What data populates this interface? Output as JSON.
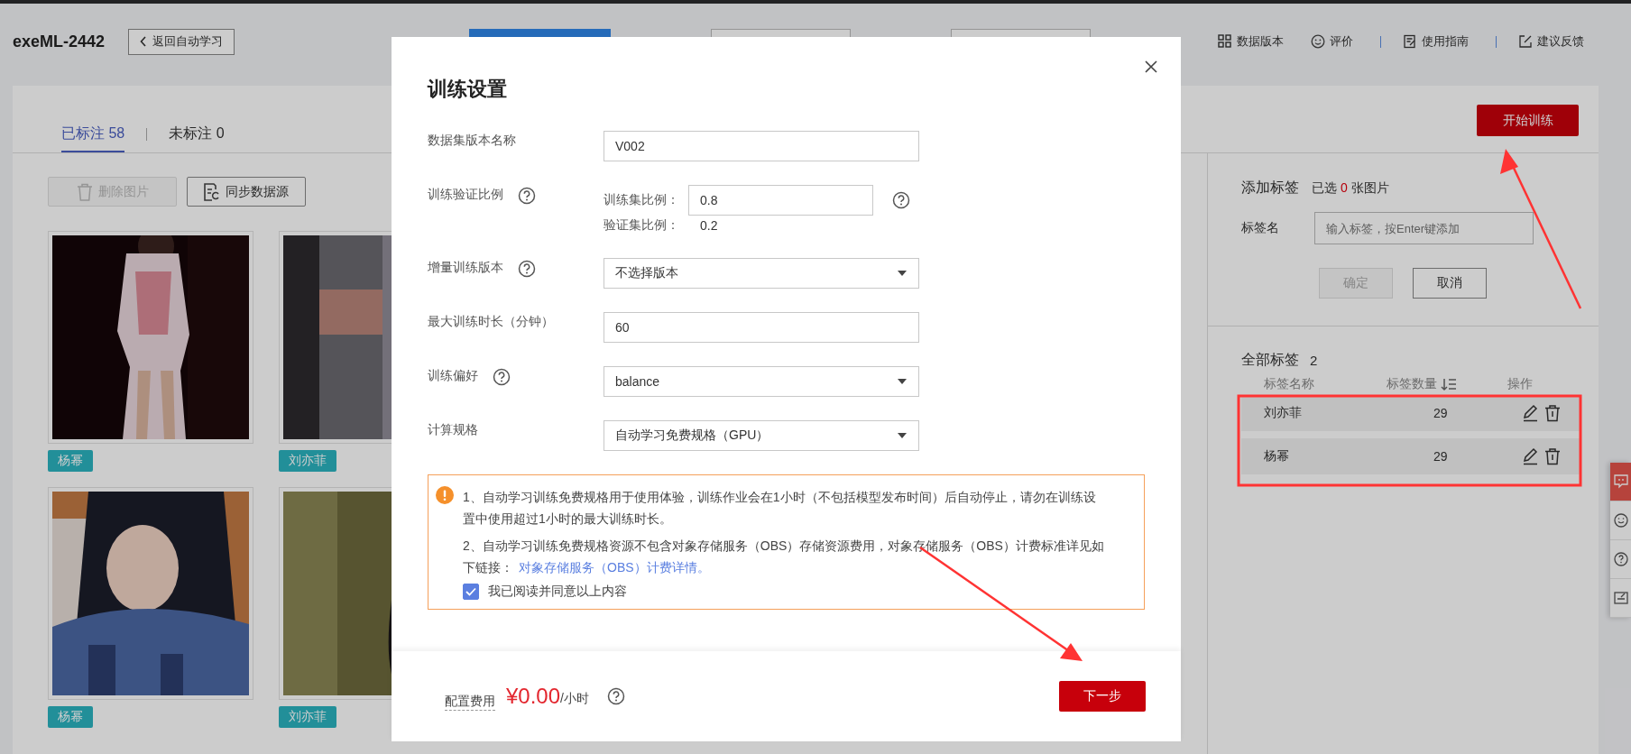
{
  "header": {
    "title": "exeML-2442",
    "back_button": "返回自动学习",
    "hidden_buttons": [
      {
        "primary": true
      },
      {
        "primary": false
      },
      {
        "primary": false
      }
    ],
    "links": [
      {
        "kind": "grid",
        "label": "数据版本"
      },
      {
        "kind": "smiley",
        "label": "评价"
      },
      {
        "kind": "guide",
        "label": "使用指南"
      },
      {
        "kind": "feedback",
        "label": "建议反馈"
      }
    ]
  },
  "tabs": [
    {
      "label": "已标注 58",
      "selected": true
    },
    {
      "label": "未标注 0",
      "selected": false
    }
  ],
  "start_button": "开始训练",
  "toolbar": {
    "delete_button": {
      "label": "删除图片",
      "disabled": true
    },
    "sync_button": {
      "label": "同步数据源",
      "disabled": false
    }
  },
  "images": [
    {
      "kind": "picture",
      "tag": "杨幂"
    },
    {
      "kind": "picture",
      "tag": "刘亦菲"
    },
    {
      "kind": "picture",
      "tag": "杨幂"
    },
    {
      "kind": "picture",
      "tag": "刘亦菲"
    }
  ],
  "add_label": {
    "title": "添加标签",
    "selected_prefix": "已选",
    "selected_count": "0",
    "selected_suffix": "张图片",
    "field_label": "标签名",
    "placeholder": "输入标签，按Enter键添加",
    "confirm_button": {
      "label": "确定",
      "disabled": true
    },
    "cancel_button": {
      "label": "取消",
      "disabled": false
    }
  },
  "all_labels": {
    "title": "全部标签",
    "count": "2",
    "columns": [
      "标签名称",
      "标签数量",
      "操作"
    ],
    "rows": [
      {
        "name": "刘亦菲",
        "count": "29"
      },
      {
        "name": "杨幂",
        "count": "29"
      }
    ]
  },
  "side_tools": [
    {
      "kind": "chat",
      "selected": true
    },
    {
      "kind": "smiley",
      "selected": false
    },
    {
      "kind": "help",
      "selected": false
    },
    {
      "kind": "edit",
      "selected": false
    }
  ],
  "modal": {
    "title": "训练设置",
    "fields": [
      {
        "kind": "text",
        "label": "数据集版本名称",
        "help": false,
        "value": "V002"
      },
      {
        "kind": "ratio",
        "label": "训练验证比例",
        "help": true,
        "train_label": "训练集比例：",
        "train_value": "0.8",
        "input_help": true,
        "val_label": "验证集比例：",
        "val_value": "0.2"
      },
      {
        "kind": "select",
        "label": "增量训练版本",
        "help": true,
        "value": "不选择版本"
      },
      {
        "kind": "text",
        "label": "最大训练时长（分钟）",
        "help": false,
        "value": "60"
      },
      {
        "kind": "select",
        "label": "训练偏好",
        "help": true,
        "value": "balance"
      },
      {
        "kind": "select",
        "label": "计算规格",
        "help": false,
        "value": "自动学习免费规格（GPU）"
      }
    ],
    "notice": {
      "paragraphs": [
        {
          "text": "1、自动学习训练免费规格用于使用体验，训练作业会在1小时（不包括模型发布时间）后自动停止，请勿在训练设置中使用超过1小时的最大训练时长。"
        },
        {
          "text": "2、自动学习训练免费规格资源不包含对象存储服务（OBS）存储资源费用，对象存储服务（OBS）计费标准详见如下链接：",
          "link": "对象存储服务（OBS）计费详情。"
        }
      ],
      "agree": {
        "label": "我已阅读并同意以上内容",
        "checked": true
      }
    },
    "footer": {
      "cost_label": "配置费用",
      "price": "¥0.00",
      "unit": "/小时",
      "next_button": "下一步"
    }
  }
}
